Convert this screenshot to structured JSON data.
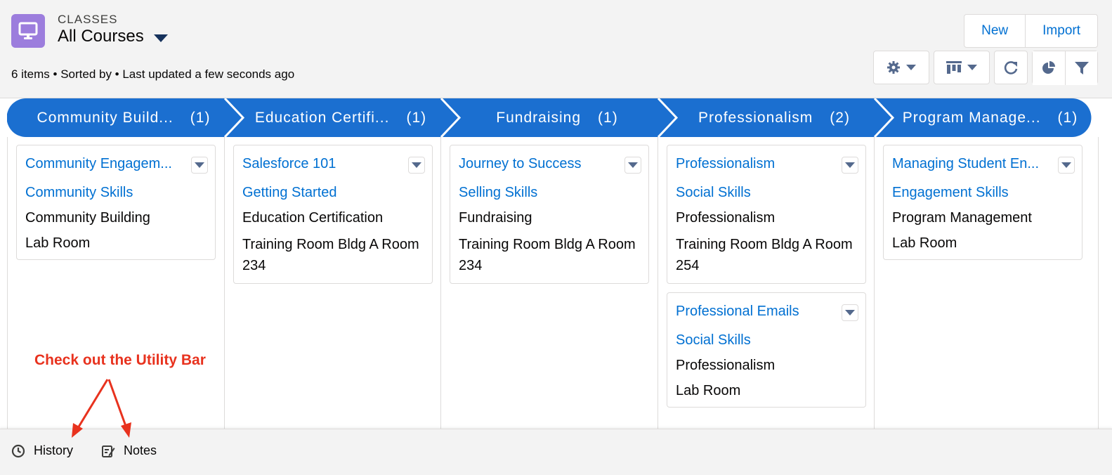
{
  "header": {
    "object_label": "CLASSES",
    "list_view_name": "All Courses",
    "meta": "6 items • Sorted by • Last updated a few seconds ago",
    "buttons": {
      "new": "New",
      "import": "Import"
    },
    "icon": "desktop-icon"
  },
  "path": [
    {
      "label": "Community Build...",
      "count": "(1)"
    },
    {
      "label": "Education Certifi...",
      "count": "(1)"
    },
    {
      "label": "Fundraising",
      "count": "(1)"
    },
    {
      "label": "Professionalism",
      "count": "(2)"
    },
    {
      "label": "Program Manage...",
      "count": "(1)"
    }
  ],
  "cards": [
    {
      "title": "Community Engagem...",
      "skill": "Community Skills",
      "category": "Community Building",
      "location": "Lab Room"
    },
    {
      "title": "Salesforce 101",
      "skill": "Getting Started",
      "category": "Education Certification",
      "location": "Training Room Bldg A Room 234"
    },
    {
      "title": "Journey to Success",
      "skill": "Selling Skills",
      "category": "Fundraising",
      "location": "Training Room Bldg A Room 234"
    },
    {
      "title": "Professionalism",
      "skill": "Social Skills",
      "category": "Professionalism",
      "location": "Training Room Bldg A Room 254"
    },
    {
      "title": "Professional Emails",
      "skill": "Social Skills",
      "category": "Professionalism",
      "location": "Lab Room"
    },
    {
      "title": "Managing Student En...",
      "skill": "Engagement Skills",
      "category": "Program Management",
      "location": "Lab Room"
    }
  ],
  "annotation": "Check out the Utility Bar",
  "utility_bar": {
    "history": "History",
    "notes": "Notes"
  },
  "colors": {
    "brand": "#0070d2",
    "path_fill": "#1b6fd0",
    "annotation": "#e8321e",
    "object_icon": "#9c7ddd"
  }
}
